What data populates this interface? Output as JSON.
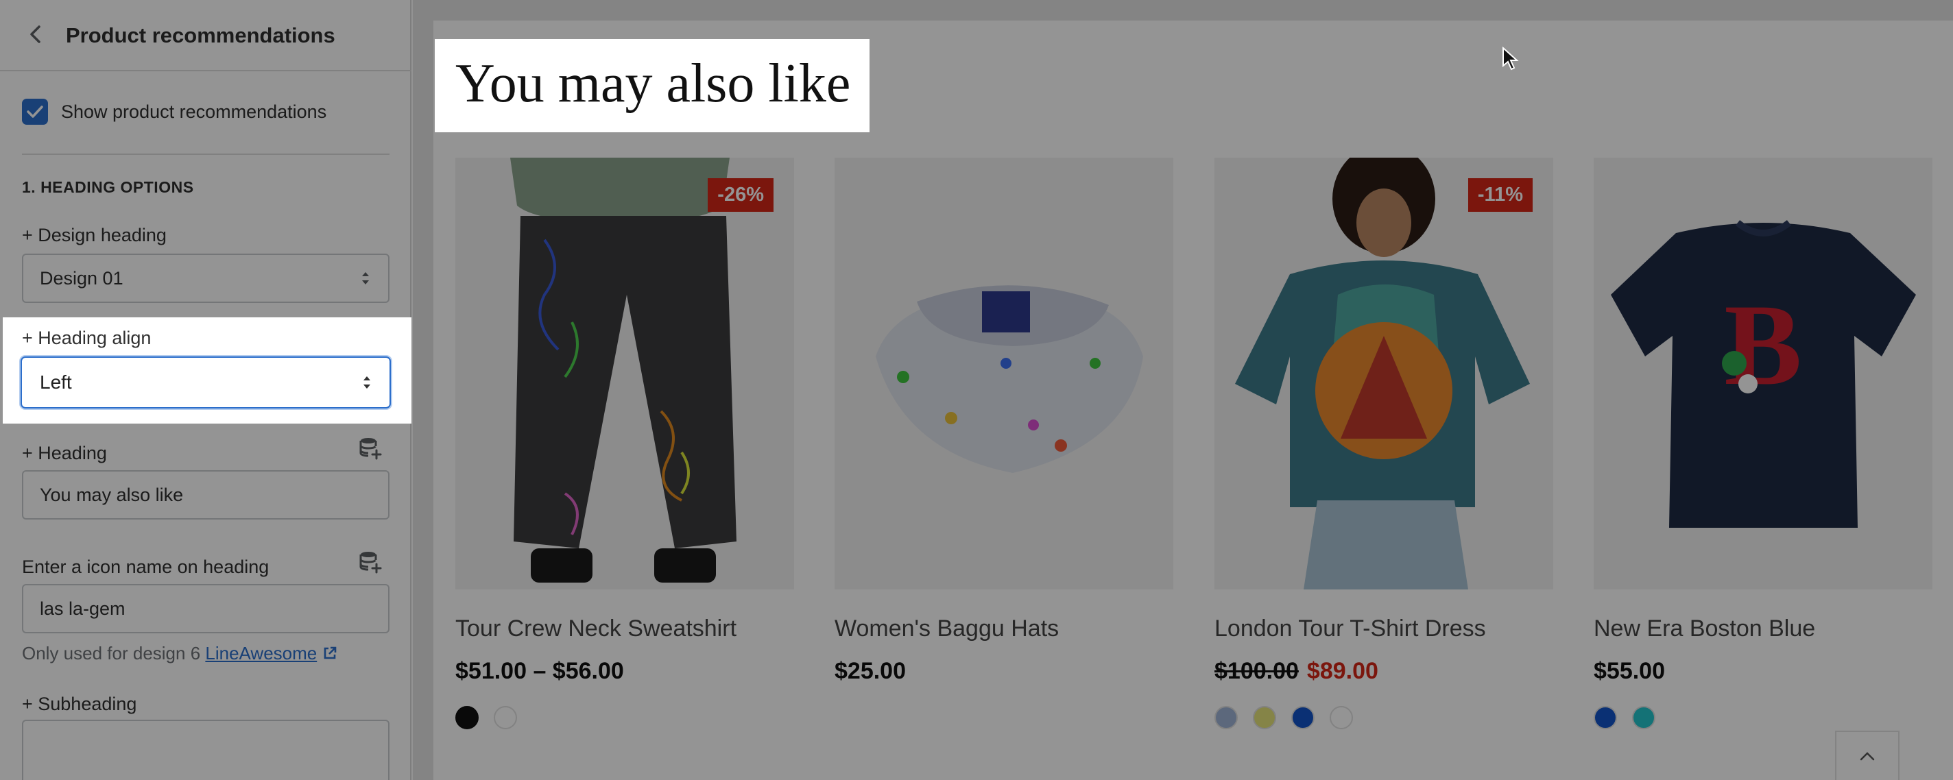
{
  "sidebar": {
    "title": "Product recommendations",
    "show_checkbox_label": "Show product recommendations",
    "section_title": "1. HEADING OPTIONS",
    "design_heading_label": "+ Design heading",
    "design_heading_value": "Design 01",
    "heading_align_label": "+ Heading align",
    "heading_align_value": "Left",
    "heading_label": "+ Heading",
    "heading_value": "You may also like",
    "icon_label": "Enter a icon name on heading",
    "icon_value": "las la-gem",
    "help_text": "Only used for design 6",
    "help_link": "LineAwesome",
    "subheading_label": "+ Subheading",
    "subheading_value": ""
  },
  "preview": {
    "heading": "You may also like",
    "products": [
      {
        "name": "Tour Crew Neck Sweatshirt",
        "price": "$51.00 – $56.00",
        "badge": "-26%",
        "swatches": [
          "#111111",
          "#ffffff"
        ]
      },
      {
        "name": "Women's Baggu Hats",
        "price": "$25.00",
        "swatches": []
      },
      {
        "name": "London Tour T-Shirt Dress",
        "old_price": "$100.00",
        "sale_price": "$89.00",
        "badge": "-11%",
        "swatches": [
          "#9fb4d6",
          "#e6e47a",
          "#1254c9",
          "#ffffff"
        ]
      },
      {
        "name": "New Era Boston Blue",
        "price": "$55.00",
        "swatches": [
          "#1254c9",
          "#23c4cc"
        ]
      }
    ]
  },
  "colors": {
    "accent": "#2c6ecb",
    "sale_red": "#d42618"
  }
}
